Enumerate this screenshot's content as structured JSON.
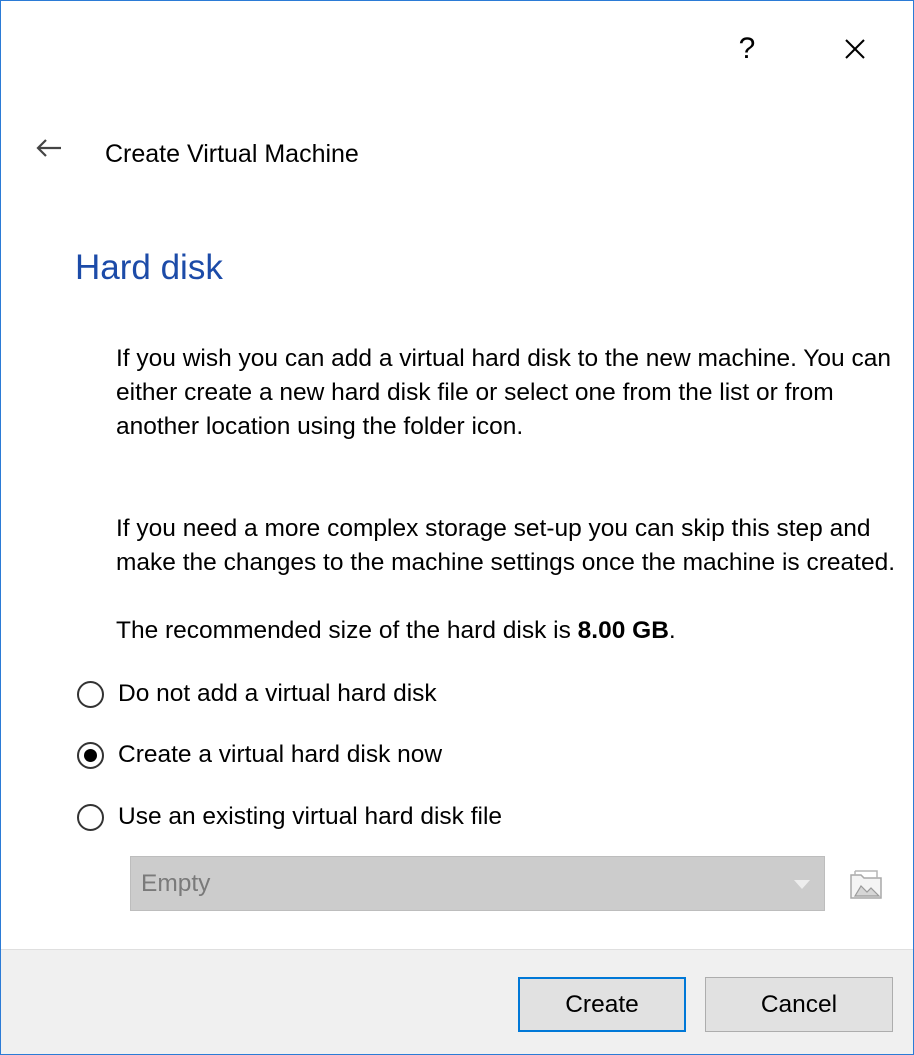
{
  "titlebar": {
    "help_label": "?",
    "close_icon": "close-icon"
  },
  "header": {
    "back_icon": "back-arrow-icon",
    "wizard_title": "Create Virtual Machine"
  },
  "page": {
    "heading": "Hard disk",
    "description_1": "If you wish you can add a virtual hard disk to the new machine. You can either create a new hard disk file or select one from the list or from another location using the folder icon.",
    "description_2": "If you need a more complex storage set-up you can skip this step and make the changes to the machine settings once the machine is created.",
    "recommend_prefix": "The recommended size of the hard disk is ",
    "recommend_value": "8.00 GB",
    "recommend_suffix": "."
  },
  "options": [
    {
      "label": "Do not add a virtual hard disk",
      "checked": false
    },
    {
      "label": "Create a virtual hard disk now",
      "checked": true
    },
    {
      "label": "Use an existing virtual hard disk file",
      "checked": false
    }
  ],
  "disk_select": {
    "value": "Empty",
    "enabled": false,
    "folder_icon": "folder-icon"
  },
  "footer": {
    "create_label": "Create",
    "cancel_label": "Cancel"
  },
  "colors": {
    "heading": "#1c4ba8",
    "window_border": "#2b7bd6",
    "default_button_border": "#0078d7",
    "footer_bg": "#f0f0f0"
  }
}
